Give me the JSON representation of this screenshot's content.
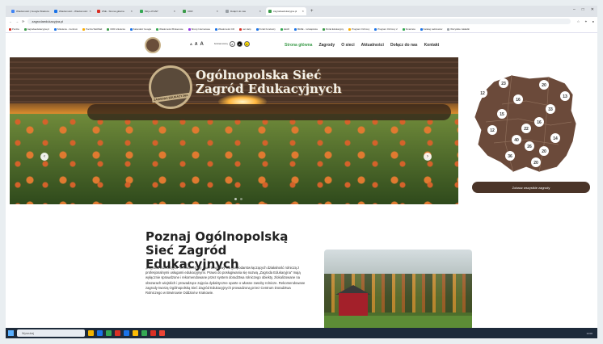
{
  "browser": {
    "tabs": [
      {
        "title": "Wiadomości | Google Wiadomości",
        "color": "#4285f4"
      },
      {
        "title": "Wiadomości - Wiadomości",
        "color": "#1a73e8"
      },
      {
        "title": "ZSE - Strona główna",
        "color": "#d93025"
      },
      {
        "title": "Mój e-PUAP",
        "color": "#34a853"
      },
      {
        "title": "CDR",
        "color": "#3c9b4a"
      },
      {
        "title": "Dołącz do nas",
        "color": "#9aa0a6"
      },
      {
        "title": "zagrodaedukacyjna.pl",
        "color": "#3c9b4a",
        "active": true
      }
    ],
    "new_tab": "+",
    "url": "zagrodaedukacyjna.pl",
    "bookmarks": [
      {
        "label": "Poczta",
        "color": "#d93025"
      },
      {
        "label": "zagrodaedukacyjna.pl",
        "color": "#3c9b4a"
      },
      {
        "label": "Szkolenie - Centrum",
        "color": "#1a73e8"
      },
      {
        "label": "Poczta WebMail",
        "color": "#f9ab00"
      },
      {
        "label": "CDR szkolenia",
        "color": "#3c9b4a"
      },
      {
        "label": "Kalendarz Google",
        "color": "#1a73e8"
      },
      {
        "label": "Wiadomości Brokerowe",
        "color": "#34a853"
      },
      {
        "label": "Strony Internetowe",
        "color": "#9334e6"
      },
      {
        "label": "Wiadomości CD",
        "color": "#1a73e8"
      },
      {
        "label": "net Help",
        "color": "#d93025"
      },
      {
        "label": "Portal Funduszy",
        "color": "#1a73e8"
      },
      {
        "label": "LEAD",
        "color": "#34a853"
      },
      {
        "label": "BASE - rozwiązania",
        "color": "#1a73e8"
      },
      {
        "label": "Portal Edukacyjny",
        "color": "#3c9b4a"
      },
      {
        "label": "Program Ochrony",
        "color": "#f9ab00"
      },
      {
        "label": "Program Ochrony 2",
        "color": "#1a73e8"
      },
      {
        "label": "Smarzeta",
        "color": "#34a853"
      },
      {
        "label": "Katalog webinarów",
        "color": "#1a73e8"
      },
      {
        "label": "Wszystkie zakładki",
        "color": "#9aa0a6"
      }
    ]
  },
  "site": {
    "font_sizes": [
      "A",
      "A",
      "A"
    ],
    "contrast_label": "Kontrast strony",
    "contrast_buttons": [
      "A",
      "A",
      "A"
    ],
    "menu": [
      "Strona główna",
      "Zagrody",
      "O sieci",
      "Aktualności",
      "Dołącz do nas",
      "Kontakt"
    ],
    "hero_title_line1": "Ogólnopolska Sieć",
    "hero_title_line2": "Zagród Edukacyjnych",
    "emblem_text": "ZAGRODA EDUKACYJNA",
    "arrow_prev": "‹",
    "arrow_next": "›",
    "map_button": "Zobacz wszystkie zagrody",
    "map_counts": [
      "23",
      "20",
      "12",
      "13",
      "16",
      "33",
      "15",
      "16",
      "22",
      "12",
      "40",
      "14",
      "26",
      "20",
      "36",
      "20"
    ],
    "intro_title": "Poznaj Ogólnopolską Sieć Zagród Edukacyjnych",
    "intro_text": "„Zagroda Edukacyjna\" to zastrzeżony znak towarowy dla gospodarstw łączących działalność rolniczą z profesjonalnymi usługami edukacyjnymi. Prawo do posługiwania się nazwą „Zagroda Edukacyjna\" mają wyłącznie sprawdzone i rekomendowane przez system doradztwa rolniczego obiekty, zlokalizowane na obszarach wiejskich i prowadzące zajęcia dydaktyczne oparte o własne zasoby rolnicze. Rekomendowane zagrody tworzą Ogólnopolską Sieć Zagród Edukacyjnych prowadzoną przez Centrum Doradztwa Rolniczego w Brwinowie Oddział w Krakowie."
  },
  "taskbar": {
    "search_placeholder": "Wyszukaj",
    "apps": [
      "#f4b400",
      "#1a73e8",
      "#34a853",
      "#d93025",
      "#1a73e8",
      "#fbbc05",
      "#34a853",
      "#d93025",
      "#ea4335"
    ],
    "time": "14:00"
  }
}
